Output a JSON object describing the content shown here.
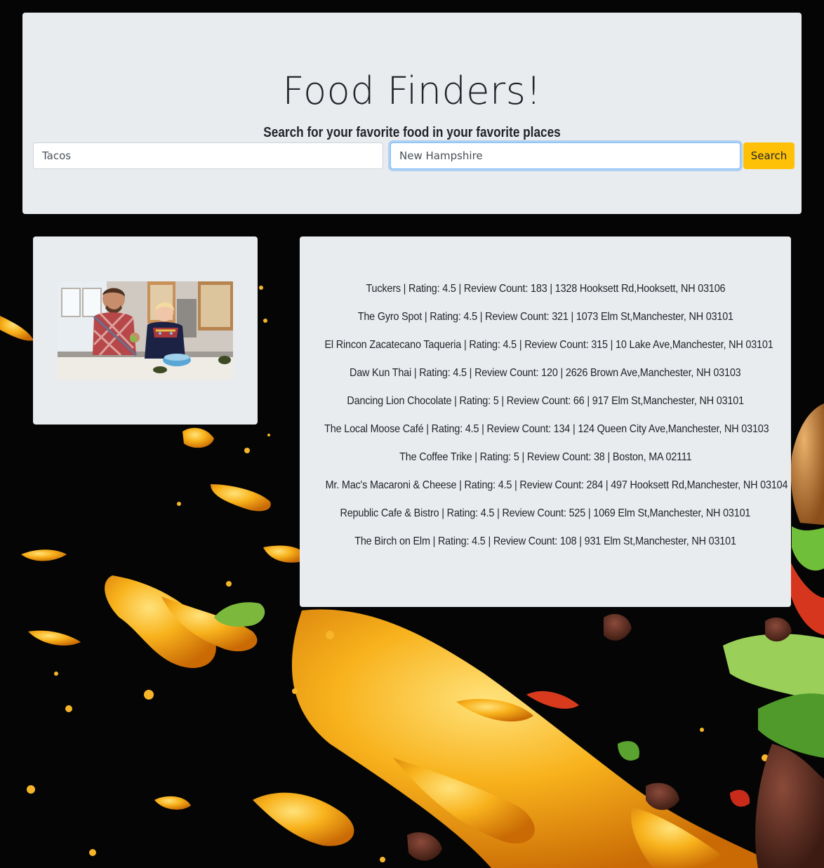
{
  "header": {
    "title": "Food Finders!",
    "subtitle": "Search for your favorite food in your favorite places"
  },
  "search": {
    "food_value": "Tacos",
    "location_value": "New Hampshire",
    "button_label": "Search"
  },
  "results": [
    "Tuckers | Rating: 4.5 | Review Count: 183 | 1328 Hooksett Rd,Hooksett, NH 03106",
    "The Gyro Spot | Rating: 4.5 | Review Count: 321 | 1073 Elm St,Manchester, NH 03101",
    "El Rincon Zacatecano Taqueria | Rating: 4.5 | Review Count: 315 | 10 Lake Ave,Manchester, NH 03101",
    "Daw Kun Thai | Rating: 4.5 | Review Count: 120 | 2626 Brown Ave,Manchester, NH 03103",
    "Dancing Lion Chocolate | Rating: 5 | Review Count: 66 | 917 Elm St,Manchester, NH 03101",
    "The Local Moose Café | Rating: 4.5 | Review Count: 134 | 124 Queen City Ave,Manchester, NH 03103",
    "The Coffee Trike | Rating: 5 | Review Count: 38 | Boston, MA 02111",
    "Mr. Mac's Macaroni & Cheese | Rating: 4.5 | Review Count: 284 | 497 Hooksett Rd,Manchester, NH 03104",
    "Republic Cafe & Bistro | Rating: 4.5 | Review Count: 525 | 1069 Elm St,Manchester, NH 03101",
    "The Birch on Elm | Rating: 4.5 | Review Count: 108 | 931 Elm St,Manchester, NH 03101"
  ],
  "colors": {
    "page_background": "#050505",
    "card_background": "#e9ecef",
    "button_accent": "#ffc107",
    "sauce": "#f5a623"
  }
}
